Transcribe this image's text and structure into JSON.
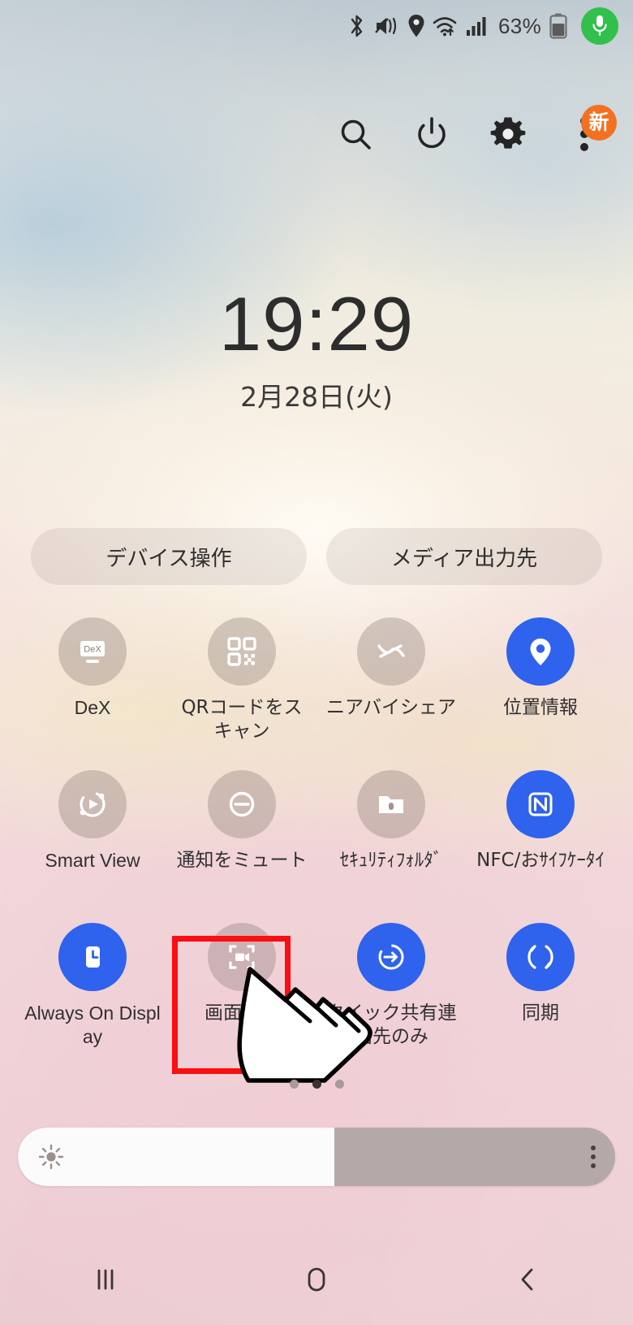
{
  "statusbar": {
    "icons": [
      "bluetooth-icon",
      "vibrate-icon",
      "location-icon",
      "wifi-icon",
      "signal-icon"
    ],
    "battery_percent": "63%",
    "battery_icon": "battery-icon",
    "mic_badge_icon": "microphone-icon"
  },
  "quick_panel_header": {
    "search_label": "search-icon",
    "power_label": "power-icon",
    "settings_label": "gear-icon",
    "more_label": "more-vertical-icon",
    "new_badge": "新"
  },
  "clock": {
    "time": "19:29",
    "date": "2月28日(火)"
  },
  "pills": [
    {
      "label": "デバイス操作",
      "name": "device-control-button"
    },
    {
      "label": "メディア出力先",
      "name": "media-output-button"
    }
  ],
  "tiles": [
    [
      {
        "label": "DeX",
        "icon": "dex-icon",
        "on": false,
        "latin": true
      },
      {
        "label": "QRコードをスキャン",
        "icon": "qr-code-icon",
        "on": false,
        "latin": false
      },
      {
        "label": "ニアバイシェア",
        "icon": "nearby-share-icon",
        "on": false,
        "latin": false
      },
      {
        "label": "位置情報",
        "icon": "location-pin-icon",
        "on": true,
        "latin": false
      }
    ],
    [
      {
        "label": "Smart View",
        "icon": "smart-view-icon",
        "on": false,
        "latin": true
      },
      {
        "label": "通知をミュート",
        "icon": "mute-notifications-icon",
        "on": false,
        "latin": false
      },
      {
        "label": "ｾｷｭﾘﾃｨﾌｫﾙﾀﾞ",
        "icon": "secure-folder-icon",
        "on": false,
        "latin": false
      },
      {
        "label": "NFC/おｻｲﾌｹｰﾀｲ",
        "icon": "nfc-icon",
        "on": true,
        "latin": false
      }
    ],
    [
      {
        "label": "Always On Display",
        "icon": "always-on-display-icon",
        "on": true,
        "latin": true
      },
      {
        "label": "画面録画",
        "icon": "screen-record-icon",
        "on": false,
        "latin": false
      },
      {
        "label": "クイック共有連絡先のみ",
        "icon": "quick-share-icon",
        "on": true,
        "latin": false
      },
      {
        "label": "同期",
        "icon": "sync-icon",
        "on": true,
        "latin": false
      }
    ]
  ],
  "highlight": {
    "target_tile": "画面録画",
    "color": "#fb0d11"
  },
  "page_dots": {
    "count": 3,
    "active_index": 1
  },
  "brightness": {
    "value_percent": 53,
    "sun_icon": "brightness-sun-icon",
    "menu_icon": "more-vertical-icon"
  },
  "navbar": [
    {
      "name": "recents-button",
      "icon": "recents-icon"
    },
    {
      "name": "home-button",
      "icon": "home-icon"
    },
    {
      "name": "back-button",
      "icon": "back-icon"
    }
  ],
  "colors": {
    "accent_blue": "#2f62ed",
    "badge_orange": "#f27121",
    "mic_green": "#31c04c",
    "highlight_red": "#fb0d11"
  }
}
